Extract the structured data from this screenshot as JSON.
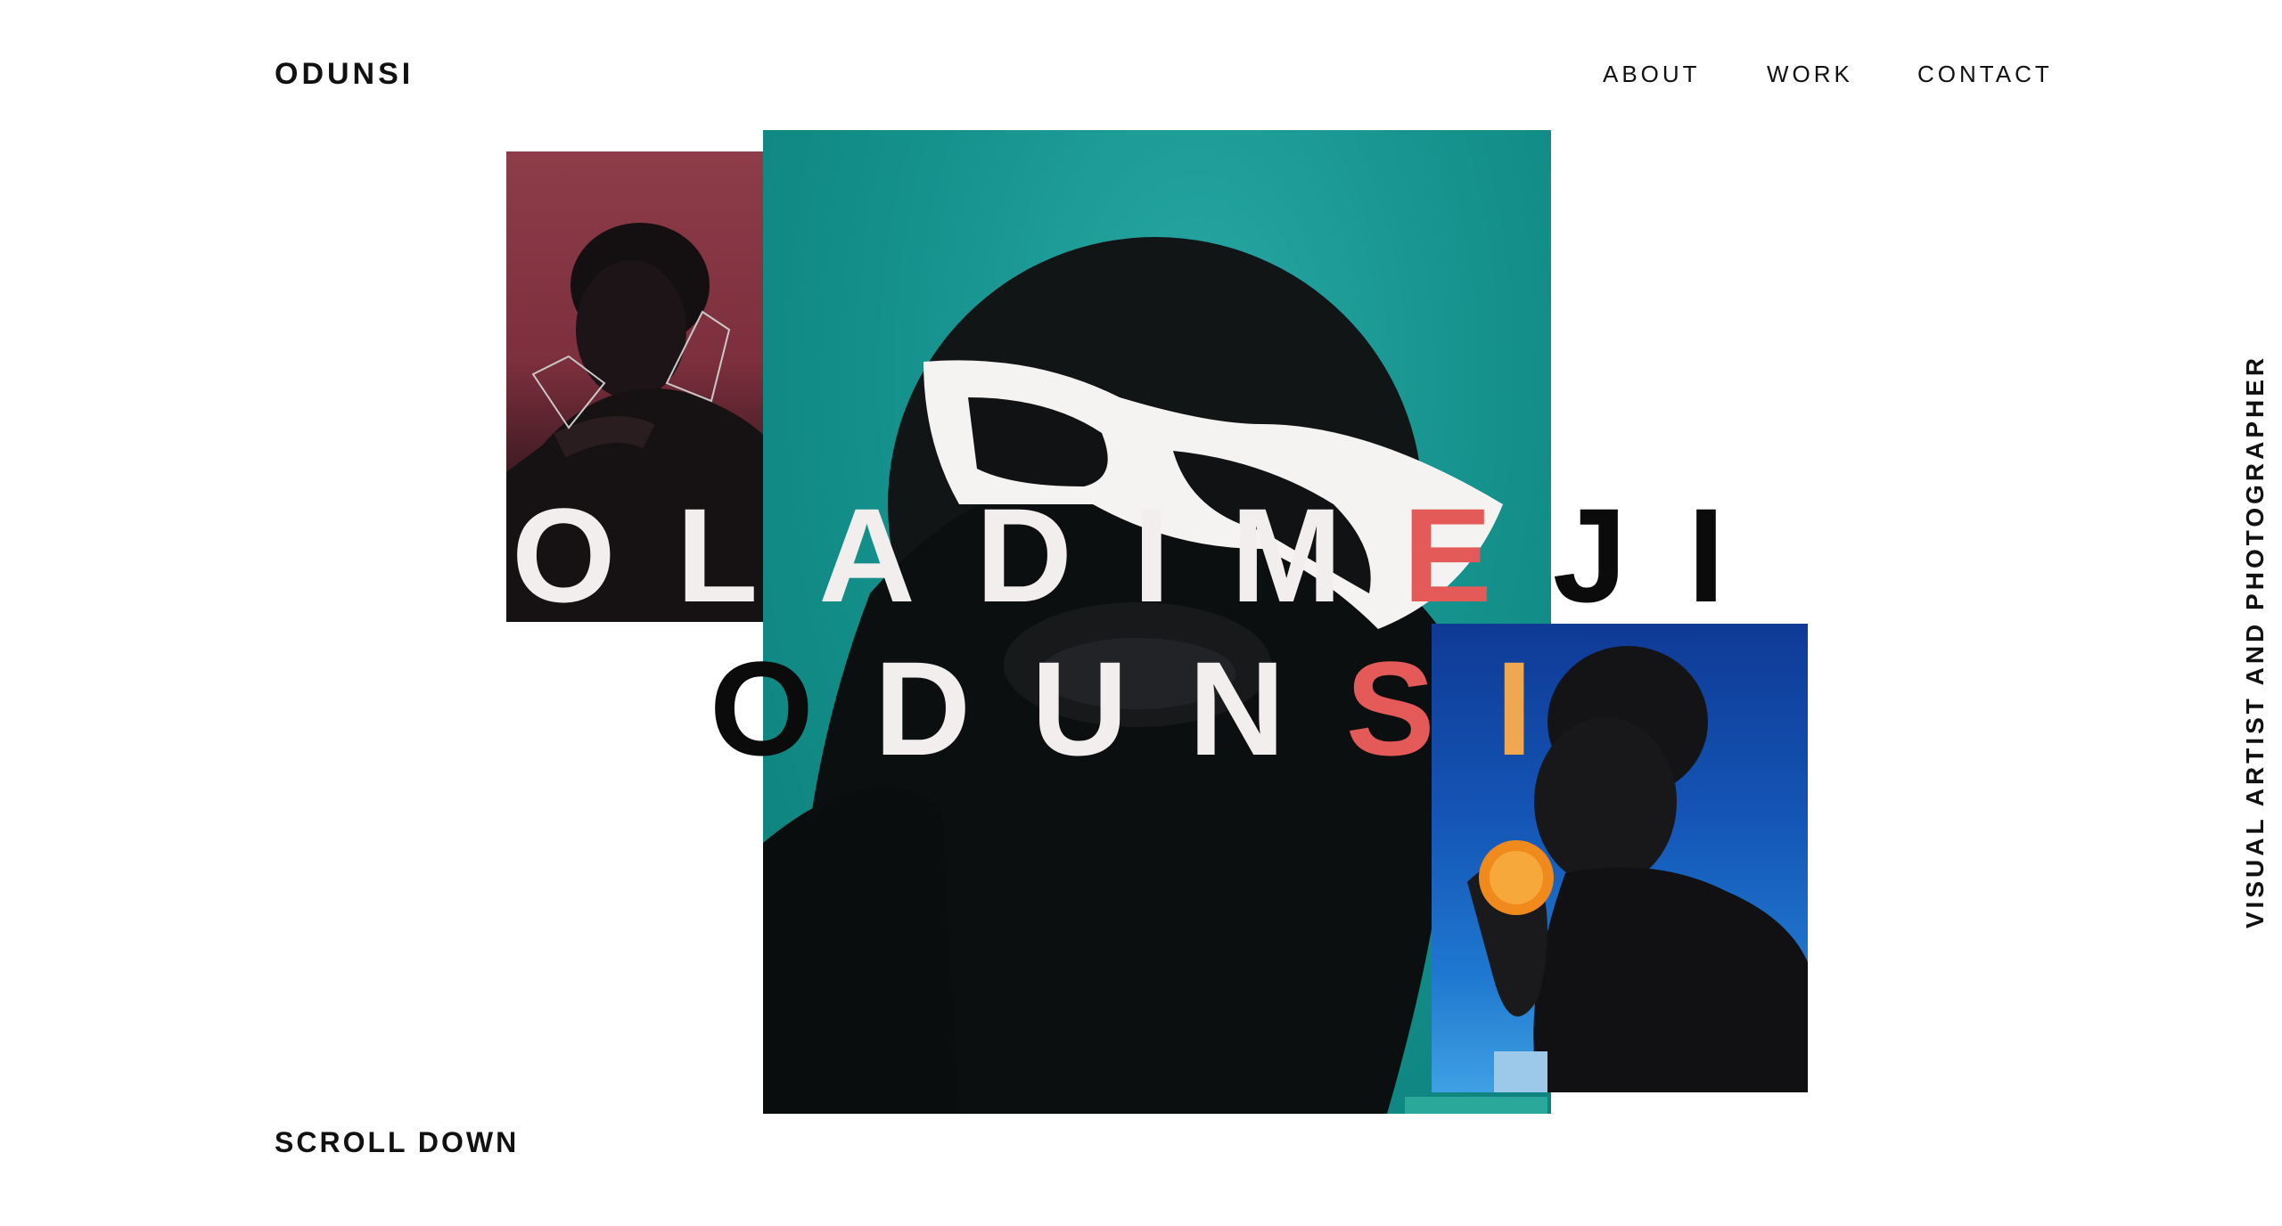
{
  "header": {
    "logo": "ODUNSI",
    "nav": [
      {
        "label": "ABOUT"
      },
      {
        "label": "WORK"
      },
      {
        "label": "CONTACT"
      }
    ]
  },
  "hero": {
    "title_line_1": [
      "O",
      "L",
      "A",
      "D",
      "I",
      "M",
      "E",
      "J",
      "I"
    ],
    "title_line_2": [
      "O",
      "D",
      "U",
      "N",
      "S",
      "I"
    ],
    "photos": [
      {
        "name": "portrait-red-background",
        "bg": "#8e3c49"
      },
      {
        "name": "portrait-teal-background-sunglasses",
        "bg": "#1a9793"
      },
      {
        "name": "portrait-blue-background-orange",
        "bg": "#1454b4"
      }
    ]
  },
  "side_text": "VISUAL ARTIST AND PHOTOGRAPHER",
  "scroll_down": "SCROLL DOWN",
  "colors": {
    "text": "#111111",
    "accent_red": "#e35a58",
    "accent_gold": "#f0a850",
    "teal": "#1a9793",
    "maroon": "#8e3c49",
    "blue": "#1454b4"
  }
}
